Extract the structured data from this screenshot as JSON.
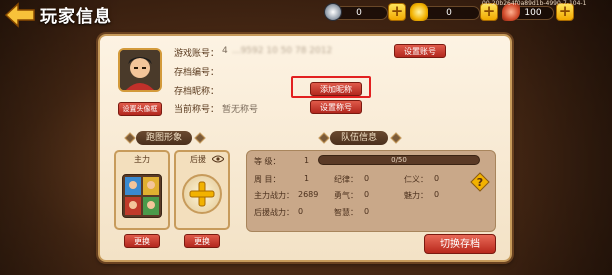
{
  "header": {
    "title": "玩家信息",
    "uid_text": "00-20b264f0a89d1b-4990-7-104-1"
  },
  "resources": [
    {
      "name": "coin",
      "value": "0",
      "icon": "silver-coin-icon"
    },
    {
      "name": "gold",
      "value": "0",
      "icon": "gold-ingot-icon"
    },
    {
      "name": "stamina",
      "value": "100",
      "icon": "meat-icon"
    }
  ],
  "account": {
    "game_account_label": "游戏账号：",
    "game_account_value": "4",
    "game_account_value_tail": "...9592  10 50 78 2012",
    "archive_id_label": "存档编号：",
    "archive_id_value": "",
    "archive_nick_label": "存档昵称：",
    "title_label": "当前称号：",
    "title_value": "暂无称号",
    "set_account_button": "设置账号",
    "add_nickname_button": "添加昵称",
    "set_title_button": "设置称号",
    "set_avatar_button": "设置头像框"
  },
  "formation": {
    "section_title": "跑图形象",
    "main_label": "主力",
    "support_label": "后援",
    "main_change_button": "更换",
    "support_change_button": "更换"
  },
  "team": {
    "section_title": "队伍信息",
    "level_label": "等    级：",
    "level_value": "1",
    "progress_text": "0/50",
    "progress": 0.0,
    "week_label": "周      目：",
    "week_value": "1",
    "discipline_label": "纪律：",
    "discipline_value": "0",
    "benevolence_label": "仁义：",
    "benevolence_value": "0",
    "main_power_label": "主力战力：",
    "main_power_value": "2689",
    "courage_label": "勇气：",
    "courage_value": "0",
    "charm_label": "魅力：",
    "charm_value": "0",
    "support_power_label": "后援战力：",
    "support_power_value": "0",
    "wisdom_label": "智慧：",
    "wisdom_value": "0"
  },
  "switch_archive_button": "切换存档",
  "colors": {
    "accent_red": "#c0302a",
    "highlight_red": "#e22020",
    "gold": "#f2b200",
    "panel": "#f6e8cf"
  }
}
